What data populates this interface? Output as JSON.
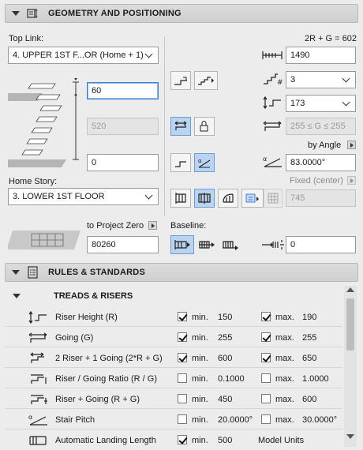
{
  "geometry": {
    "title": "GEOMETRY AND POSITIONING",
    "top_link": {
      "label": "Top Link:",
      "value": "4. UPPER 1ST F...OR (Home + 1)"
    },
    "top_offset": "60",
    "height_disabled": "520",
    "bottom_offset": "0",
    "home_story": {
      "label": "Home Story:",
      "value": "3. LOWER 1ST FLOOR"
    },
    "to_project_zero": {
      "label": "to Project Zero",
      "value": "80260"
    },
    "formula": "2R + G = 602",
    "total_length": "1490",
    "risers_count": "3",
    "riser_height": "173",
    "going_range": "255 ≤ G ≤ 255",
    "by_angle_label": "by Angle",
    "angle": "83.0000°",
    "fixed_center_label": "Fixed (center)",
    "fixed_value": "745",
    "baseline": {
      "label": "Baseline:",
      "offset": "0"
    }
  },
  "rules": {
    "title": "RULES & STANDARDS",
    "group": "TREADS & RISERS",
    "min_label": "min.",
    "max_label": "max.",
    "rows": [
      {
        "name": "Riser Height (R)",
        "min_on": true,
        "min": "150",
        "max_on": true,
        "max": "190"
      },
      {
        "name": "Going (G)",
        "min_on": true,
        "min": "255",
        "max_on": true,
        "max": "255"
      },
      {
        "name": "2 Riser + 1 Going (2*R + G)",
        "min_on": true,
        "min": "600",
        "max_on": true,
        "max": "650"
      },
      {
        "name": "Riser / Going Ratio (R / G)",
        "min_on": false,
        "min": "0.1000",
        "max_on": false,
        "max": "1.0000"
      },
      {
        "name": "Riser + Going (R + G)",
        "min_on": false,
        "min": "450",
        "max_on": false,
        "max": "600"
      },
      {
        "name": "Stair Pitch",
        "min_on": false,
        "min": "20.0000°",
        "max_on": false,
        "max": "30.0000°"
      },
      {
        "name": "Automatic Landing Length",
        "min_on": true,
        "min": "500",
        "max_on": null,
        "max": "Model Units"
      }
    ]
  },
  "colors": {
    "accent": "#3d7fd6",
    "toggle_on": "#b9d3f0"
  }
}
